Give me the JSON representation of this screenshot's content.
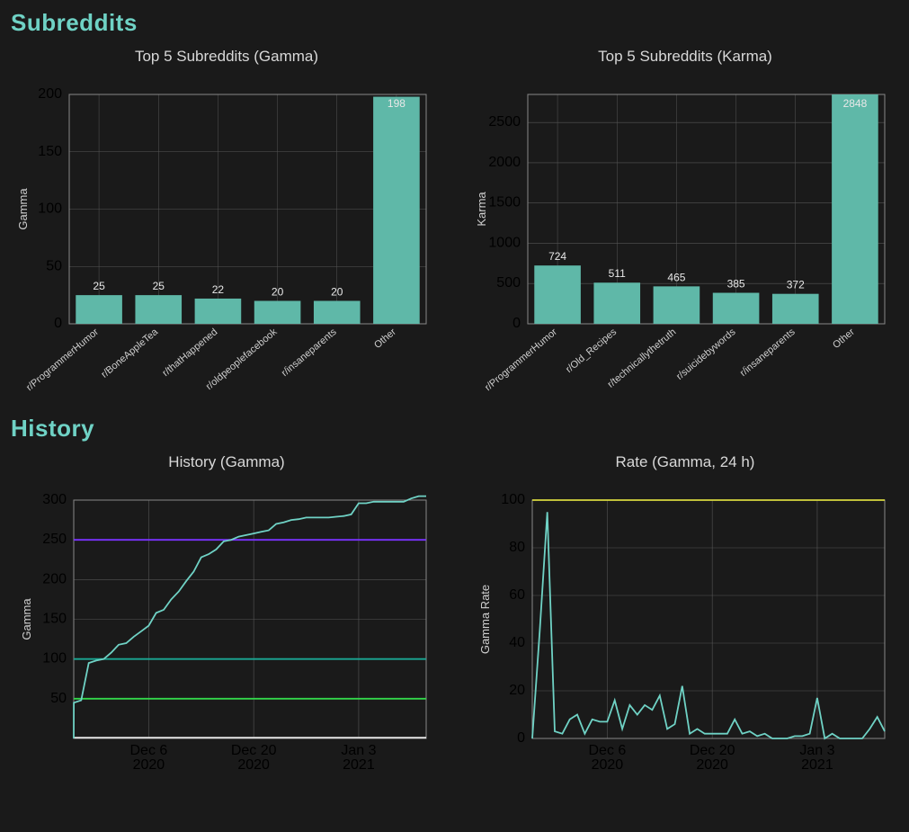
{
  "sections": {
    "subreddits": {
      "heading": "Subreddits"
    },
    "history": {
      "heading": "History"
    }
  },
  "colors": {
    "bar": "#5fb8a8",
    "line": "#6fd2c5",
    "ref_250": "#7a33ff",
    "ref_100": "#1aa894",
    "ref_50": "#33d84b",
    "ref_0": "#e6e6e6",
    "rate_100": "#d9d93f"
  },
  "chart_data": [
    {
      "id": "top_gamma",
      "type": "bar",
      "title": "Top 5 Subreddits (Gamma)",
      "ylabel": "Gamma",
      "ylim": [
        0,
        200
      ],
      "yticks": [
        0,
        50,
        100,
        150,
        200
      ],
      "categories": [
        "r/ProgrammerHumor",
        "r/BoneAppleTea",
        "r/thatHappened",
        "r/oldpeoplefacebook",
        "r/insaneparents",
        "Other"
      ],
      "values": [
        25,
        25,
        22,
        20,
        20,
        198
      ]
    },
    {
      "id": "top_karma",
      "type": "bar",
      "title": "Top 5 Subreddits (Karma)",
      "ylabel": "Karma",
      "ylim": [
        0,
        2848
      ],
      "yticks": [
        0,
        500,
        1000,
        1500,
        2000,
        2500
      ],
      "categories": [
        "r/ProgrammerHumor",
        "r/Old_Recipes",
        "r/technicallythetruth",
        "r/suicidebywords",
        "r/insaneparents",
        "Other"
      ],
      "values": [
        724,
        511,
        465,
        385,
        372,
        2848
      ]
    },
    {
      "id": "history_gamma",
      "type": "line",
      "title": "History (Gamma)",
      "ylabel": "Gamma",
      "ylim": [
        0,
        300
      ],
      "yticks": [
        50,
        100,
        150,
        200,
        250,
        300
      ],
      "x_range": [
        0,
        47
      ],
      "x_ticks": [
        {
          "t": 10,
          "label_top": "Dec 6",
          "label_bottom": "2020"
        },
        {
          "t": 24,
          "label_top": "Dec 20",
          "label_bottom": "2020"
        },
        {
          "t": 38,
          "label_top": "Jan 3",
          "label_bottom": "2021"
        }
      ],
      "reference_lines": [
        {
          "y": 250,
          "color_key": "ref_250"
        },
        {
          "y": 100,
          "color_key": "ref_100"
        },
        {
          "y": 50,
          "color_key": "ref_50"
        },
        {
          "y": 1,
          "color_key": "ref_0"
        }
      ],
      "series": [
        {
          "name": "Gamma",
          "points": [
            {
              "t": 0,
              "y": 0
            },
            {
              "t": 0.01,
              "y": 45
            },
            {
              "t": 1,
              "y": 48
            },
            {
              "t": 2,
              "y": 95
            },
            {
              "t": 3,
              "y": 98
            },
            {
              "t": 4,
              "y": 100
            },
            {
              "t": 5,
              "y": 108
            },
            {
              "t": 6,
              "y": 118
            },
            {
              "t": 7,
              "y": 120
            },
            {
              "t": 8,
              "y": 128
            },
            {
              "t": 9,
              "y": 135
            },
            {
              "t": 10,
              "y": 142
            },
            {
              "t": 11,
              "y": 158
            },
            {
              "t": 12,
              "y": 162
            },
            {
              "t": 13,
              "y": 175
            },
            {
              "t": 14,
              "y": 185
            },
            {
              "t": 15,
              "y": 198
            },
            {
              "t": 16,
              "y": 210
            },
            {
              "t": 17,
              "y": 228
            },
            {
              "t": 18,
              "y": 232
            },
            {
              "t": 19,
              "y": 238
            },
            {
              "t": 20,
              "y": 248
            },
            {
              "t": 21,
              "y": 250
            },
            {
              "t": 22,
              "y": 254
            },
            {
              "t": 23,
              "y": 256
            },
            {
              "t": 24,
              "y": 258
            },
            {
              "t": 25,
              "y": 260
            },
            {
              "t": 26,
              "y": 262
            },
            {
              "t": 27,
              "y": 270
            },
            {
              "t": 28,
              "y": 272
            },
            {
              "t": 29,
              "y": 275
            },
            {
              "t": 30,
              "y": 276
            },
            {
              "t": 31,
              "y": 278
            },
            {
              "t": 32,
              "y": 278
            },
            {
              "t": 33,
              "y": 278
            },
            {
              "t": 34,
              "y": 278
            },
            {
              "t": 35,
              "y": 279
            },
            {
              "t": 36,
              "y": 280
            },
            {
              "t": 37,
              "y": 282
            },
            {
              "t": 38,
              "y": 296
            },
            {
              "t": 39,
              "y": 296
            },
            {
              "t": 40,
              "y": 298
            },
            {
              "t": 41,
              "y": 298
            },
            {
              "t": 42,
              "y": 298
            },
            {
              "t": 43,
              "y": 298
            },
            {
              "t": 44,
              "y": 298
            },
            {
              "t": 45,
              "y": 302
            },
            {
              "t": 46,
              "y": 305
            },
            {
              "t": 47,
              "y": 305
            }
          ]
        }
      ]
    },
    {
      "id": "rate_gamma",
      "type": "line",
      "title": "Rate (Gamma, 24 h)",
      "ylabel": "Gamma Rate",
      "ylim": [
        0,
        100
      ],
      "yticks": [
        0,
        20,
        40,
        60,
        80,
        100
      ],
      "x_range": [
        0,
        47
      ],
      "x_ticks": [
        {
          "t": 10,
          "label_top": "Dec 6",
          "label_bottom": "2020"
        },
        {
          "t": 24,
          "label_top": "Dec 20",
          "label_bottom": "2020"
        },
        {
          "t": 38,
          "label_top": "Jan 3",
          "label_bottom": "2021"
        }
      ],
      "reference_lines": [
        {
          "y": 100,
          "color_key": "rate_100"
        }
      ],
      "series": [
        {
          "name": "Gamma Rate",
          "points": [
            {
              "t": 0,
              "y": 0
            },
            {
              "t": 1,
              "y": 45
            },
            {
              "t": 2,
              "y": 95
            },
            {
              "t": 3,
              "y": 3
            },
            {
              "t": 4,
              "y": 2
            },
            {
              "t": 5,
              "y": 8
            },
            {
              "t": 6,
              "y": 10
            },
            {
              "t": 7,
              "y": 2
            },
            {
              "t": 8,
              "y": 8
            },
            {
              "t": 9,
              "y": 7
            },
            {
              "t": 10,
              "y": 7
            },
            {
              "t": 11,
              "y": 16
            },
            {
              "t": 12,
              "y": 4
            },
            {
              "t": 13,
              "y": 14
            },
            {
              "t": 14,
              "y": 10
            },
            {
              "t": 15,
              "y": 14
            },
            {
              "t": 16,
              "y": 12
            },
            {
              "t": 17,
              "y": 18
            },
            {
              "t": 18,
              "y": 4
            },
            {
              "t": 19,
              "y": 6
            },
            {
              "t": 20,
              "y": 22
            },
            {
              "t": 21,
              "y": 2
            },
            {
              "t": 22,
              "y": 4
            },
            {
              "t": 23,
              "y": 2
            },
            {
              "t": 24,
              "y": 2
            },
            {
              "t": 25,
              "y": 2
            },
            {
              "t": 26,
              "y": 2
            },
            {
              "t": 27,
              "y": 8
            },
            {
              "t": 28,
              "y": 2
            },
            {
              "t": 29,
              "y": 3
            },
            {
              "t": 30,
              "y": 1
            },
            {
              "t": 31,
              "y": 2
            },
            {
              "t": 32,
              "y": 0
            },
            {
              "t": 33,
              "y": 0
            },
            {
              "t": 34,
              "y": 0
            },
            {
              "t": 35,
              "y": 1
            },
            {
              "t": 36,
              "y": 1
            },
            {
              "t": 37,
              "y": 2
            },
            {
              "t": 38,
              "y": 17
            },
            {
              "t": 39,
              "y": 0
            },
            {
              "t": 40,
              "y": 2
            },
            {
              "t": 41,
              "y": 0
            },
            {
              "t": 42,
              "y": 0
            },
            {
              "t": 43,
              "y": 0
            },
            {
              "t": 44,
              "y": 0
            },
            {
              "t": 45,
              "y": 4
            },
            {
              "t": 46,
              "y": 9
            },
            {
              "t": 47,
              "y": 3
            }
          ]
        }
      ]
    }
  ]
}
